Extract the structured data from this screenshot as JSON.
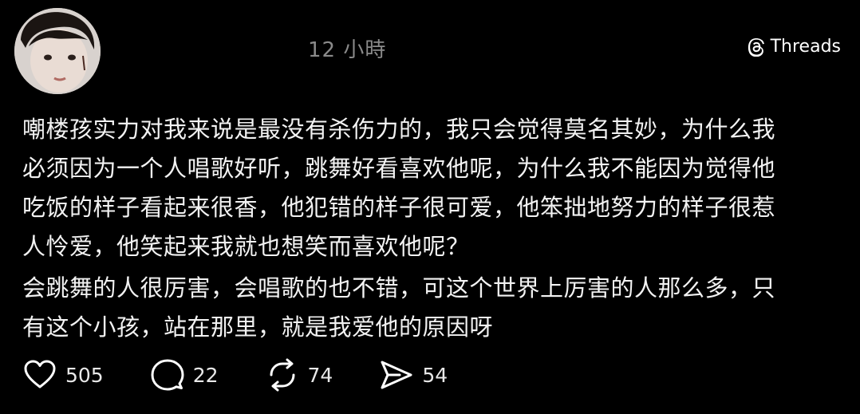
{
  "post": {
    "timestamp": "12 小時",
    "brand": "Threads",
    "paragraphs": [
      "嘲楼孩实力对我来说是最没有杀伤力的，我只会觉得莫名其妙，为什么我\n必须因为一个人唱歌好听，跳舞好看喜欢他呢，为什么我不能因为觉得他\n吃饭的样子看起来很香，他犯错的样子很可爱，他笨拙地努力的样子很惹\n人怜爱，他笑起来我就也想笑而喜欢他呢？",
      "会跳舞的人很厉害，会唱歌的也不错，可这个世界上厉害的人那么多，只\n有这个小孩，站在那里，就是我爱他的原因呀"
    ],
    "actions": {
      "likes": "505",
      "replies": "22",
      "reposts": "74",
      "shares": "54"
    }
  },
  "icons": {
    "avatar": "avatar-photo",
    "brand": "threads-logo-icon",
    "like": "heart-icon",
    "reply": "comment-bubble-icon",
    "repost": "repost-icon",
    "share": "send-icon"
  },
  "colors": {
    "background": "#000000",
    "text": "#f2f2f2",
    "muted": "#8a8a8a"
  }
}
